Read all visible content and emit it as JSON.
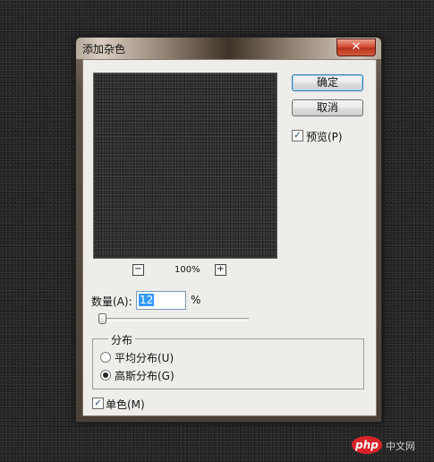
{
  "dialog": {
    "title": "添加杂色",
    "close_glyph": "✕",
    "buttons": {
      "ok": "确定",
      "cancel": "取消"
    },
    "preview_checkbox": {
      "label": "预览(P)",
      "checked": true,
      "mark": "✓"
    },
    "zoom": {
      "minus": "−",
      "plus": "+",
      "level": "100%"
    },
    "amount": {
      "label": "数量(A):",
      "value": "12",
      "unit": "%"
    },
    "distribution": {
      "legend": "分布",
      "options": [
        {
          "label": "平均分布(U)",
          "selected": false
        },
        {
          "label": "高斯分布(G)",
          "selected": true
        }
      ]
    },
    "monochrome": {
      "label": "单色(M)",
      "checked": true,
      "mark": "✓"
    }
  },
  "watermark": {
    "logo": "php",
    "text": "中文网"
  },
  "colors": {
    "accent": "#3399ff",
    "close": "#c8442d",
    "dialog_bg": "#eeede9"
  }
}
